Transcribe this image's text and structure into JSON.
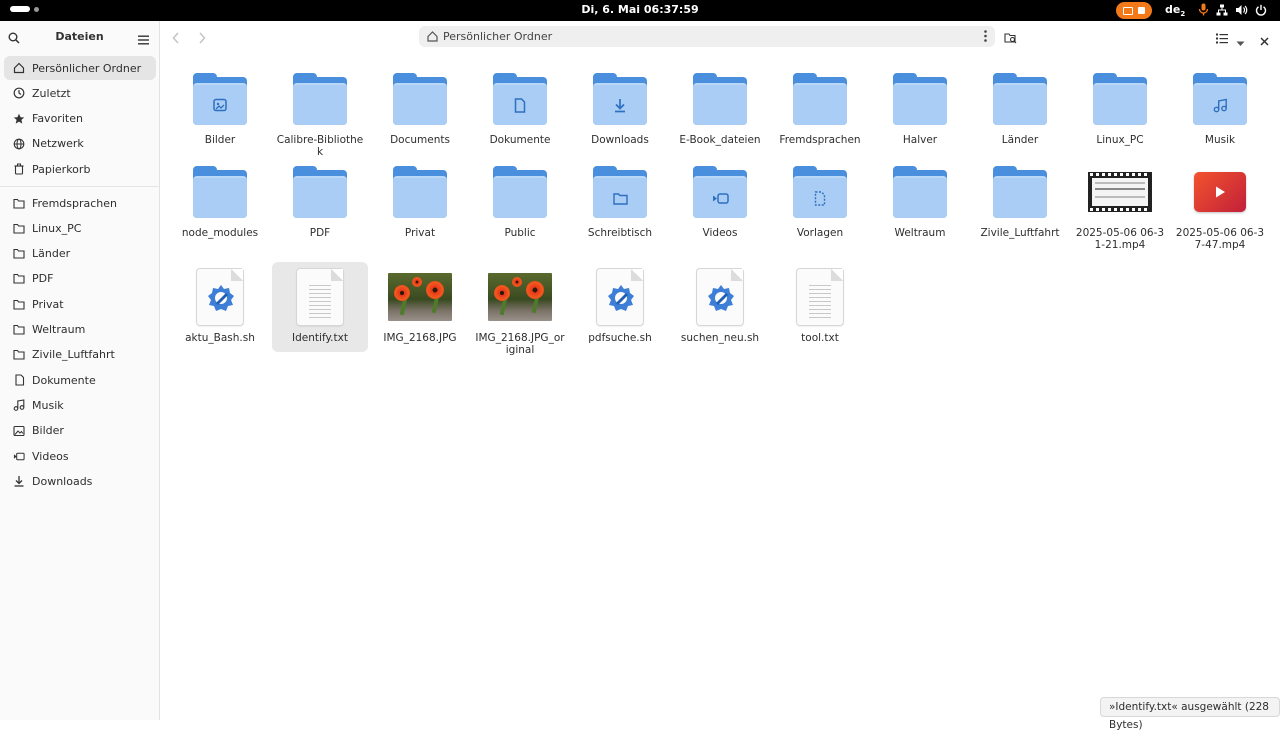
{
  "topbar": {
    "clock": "Di, 6. Mai  06:37:59",
    "keyboard_layout": "de",
    "keyboard_sub": "2",
    "recording_color": "#f47a19"
  },
  "sidebar": {
    "title": "Dateien",
    "places": [
      {
        "label": "Persönlicher Ordner",
        "icon": "home-icon"
      },
      {
        "label": "Zuletzt",
        "icon": "recent-icon"
      },
      {
        "label": "Favoriten",
        "icon": "star-icon"
      },
      {
        "label": "Netzwerk",
        "icon": "network-icon"
      },
      {
        "label": "Papierkorb",
        "icon": "trash-icon"
      }
    ],
    "bookmarks": [
      {
        "label": "Fremdsprachen",
        "icon": "folder-icon"
      },
      {
        "label": "Linux_PC",
        "icon": "folder-icon"
      },
      {
        "label": "Länder",
        "icon": "folder-icon"
      },
      {
        "label": "PDF",
        "icon": "folder-icon"
      },
      {
        "label": "Privat",
        "icon": "folder-icon"
      },
      {
        "label": "Weltraum",
        "icon": "folder-icon"
      },
      {
        "label": "Zivile_Luftfahrt",
        "icon": "folder-icon"
      },
      {
        "label": "Dokumente",
        "icon": "document-icon"
      },
      {
        "label": "Musik",
        "icon": "music-icon"
      },
      {
        "label": "Bilder",
        "icon": "image-icon"
      },
      {
        "label": "Videos",
        "icon": "video-icon"
      },
      {
        "label": "Downloads",
        "icon": "download-icon"
      }
    ]
  },
  "header": {
    "path": "Persönlicher Ordner"
  },
  "files": [
    {
      "name": "Bilder",
      "kind": "folder",
      "emblem": "image"
    },
    {
      "name": "Calibre-Bibliothek",
      "kind": "folder",
      "emblem": ""
    },
    {
      "name": "Documents",
      "kind": "folder",
      "emblem": ""
    },
    {
      "name": "Dokumente",
      "kind": "folder",
      "emblem": "document"
    },
    {
      "name": "Downloads",
      "kind": "folder",
      "emblem": "download"
    },
    {
      "name": "E-Book_dateien",
      "kind": "folder",
      "emblem": ""
    },
    {
      "name": "Fremdsprachen",
      "kind": "folder",
      "emblem": ""
    },
    {
      "name": "Halver",
      "kind": "folder",
      "emblem": ""
    },
    {
      "name": "Länder",
      "kind": "folder",
      "emblem": ""
    },
    {
      "name": "Linux_PC",
      "kind": "folder",
      "emblem": ""
    },
    {
      "name": "Musik",
      "kind": "folder",
      "emblem": "music"
    },
    {
      "name": "node_modules",
      "kind": "folder",
      "emblem": ""
    },
    {
      "name": "PDF",
      "kind": "folder",
      "emblem": ""
    },
    {
      "name": "Privat",
      "kind": "folder",
      "emblem": ""
    },
    {
      "name": "Public",
      "kind": "folder",
      "emblem": ""
    },
    {
      "name": "Schreibtisch",
      "kind": "folder",
      "emblem": "desktop"
    },
    {
      "name": "Videos",
      "kind": "folder",
      "emblem": "video"
    },
    {
      "name": "Vorlagen",
      "kind": "folder",
      "emblem": "template"
    },
    {
      "name": "Weltraum",
      "kind": "folder",
      "emblem": ""
    },
    {
      "name": "Zivile_Luftfahrt",
      "kind": "folder",
      "emblem": ""
    },
    {
      "name": "2025-05-06 06-31-21.mp4",
      "kind": "video-film",
      "emblem": ""
    },
    {
      "name": "2025-05-06 06-37-47.mp4",
      "kind": "video-red",
      "emblem": ""
    },
    {
      "name": "aktu_Bash.sh",
      "kind": "script",
      "emblem": ""
    },
    {
      "name": "Identify.txt",
      "kind": "text",
      "emblem": "",
      "selected": true
    },
    {
      "name": "IMG_2168.JPG",
      "kind": "photo",
      "emblem": ""
    },
    {
      "name": "IMG_2168.JPG_original",
      "kind": "photo",
      "emblem": ""
    },
    {
      "name": "pdfsuche.sh",
      "kind": "script",
      "emblem": ""
    },
    {
      "name": "suchen_neu.sh",
      "kind": "script",
      "emblem": ""
    },
    {
      "name": "tool.txt",
      "kind": "text",
      "emblem": ""
    }
  ],
  "status": {
    "text": "»Identify.txt« ausgewählt  (228 Bytes)"
  },
  "colors": {
    "folder_back": "#4a8fde",
    "folder_front": "#a9cdf4",
    "selection": "#e8e8e8",
    "sidebar_bg": "#fafafa"
  }
}
